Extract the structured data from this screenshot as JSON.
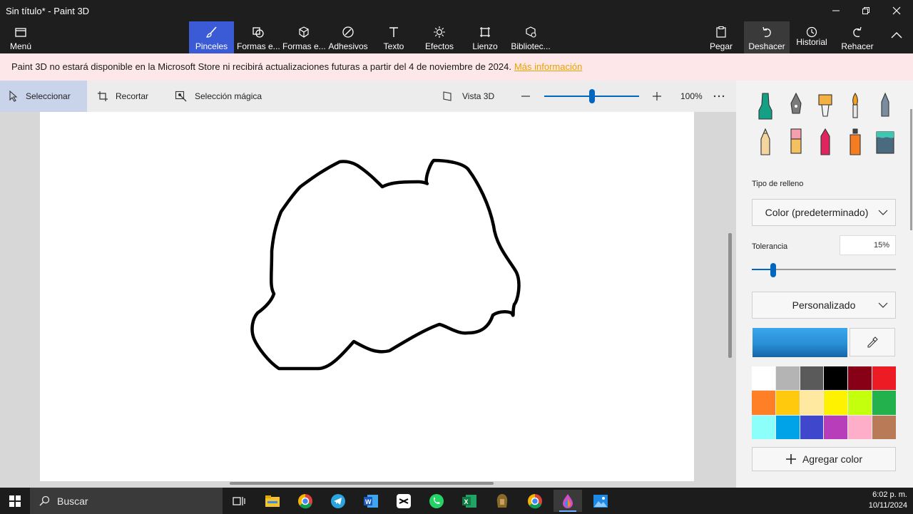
{
  "window": {
    "title": "Sin título* - Paint 3D"
  },
  "ribbon": {
    "menu": "Menú",
    "tabs": [
      {
        "label": "Pinceles",
        "icon": "brush-icon"
      },
      {
        "label": "Formas e...",
        "icon": "shapes-2d-icon"
      },
      {
        "label": "Formas e...",
        "icon": "shapes-3d-icon"
      },
      {
        "label": "Adhesivos",
        "icon": "sticker-icon"
      },
      {
        "label": "Texto",
        "icon": "text-icon"
      },
      {
        "label": "Efectos",
        "icon": "effects-icon"
      },
      {
        "label": "Lienzo",
        "icon": "canvas-icon"
      },
      {
        "label": "Bibliotec...",
        "icon": "library-icon"
      }
    ],
    "actions": {
      "paste": "Pegar",
      "undo": "Deshacer",
      "history": "Historial",
      "redo": "Rehacer"
    }
  },
  "notice": {
    "text": "Paint 3D no estará disponible en la Microsoft Store ni recibirá actualizaciones futuras a partir del 4 de noviembre de 2024.",
    "link": "Más información"
  },
  "subtoolbar": {
    "select": "Seleccionar",
    "crop": "Recortar",
    "magic_select": "Selección mágica",
    "view3d": "Vista 3D",
    "zoom": "100%",
    "zoom_level": 0.5
  },
  "panel": {
    "fill_type_label": "Tipo de relleno",
    "fill_type_value": "Color (predeterminado)",
    "tolerance_label": "Tolerancia",
    "tolerance_value": "15%",
    "tolerance_fraction": 0.15,
    "custom_dropdown": "Personalizado",
    "add_color": "Agregar color",
    "current_color": "#2a8fd6",
    "palette": [
      "#ffffff",
      "#b4b4b4",
      "#5a5a5a",
      "#000000",
      "#880015",
      "#ed1c24",
      "#ff7f27",
      "#ffc90e",
      "#ffe8a0",
      "#fff200",
      "#c4ff0e",
      "#22b14c",
      "#8cfffb",
      "#00a2e8",
      "#3f48cc",
      "#b83dba",
      "#ffaec9",
      "#b97a57"
    ]
  },
  "taskbar": {
    "search": "Buscar",
    "apps": [
      "task-view-icon",
      "file-explorer-icon",
      "chrome-icon",
      "telegram-icon",
      "word-icon",
      "capcut-icon",
      "whatsapp-icon",
      "excel-icon",
      "game-icon",
      "chrome-icon",
      "paint3d-icon",
      "photos-icon"
    ],
    "time": "6:02 p. m.",
    "date": "10/11/2024"
  }
}
